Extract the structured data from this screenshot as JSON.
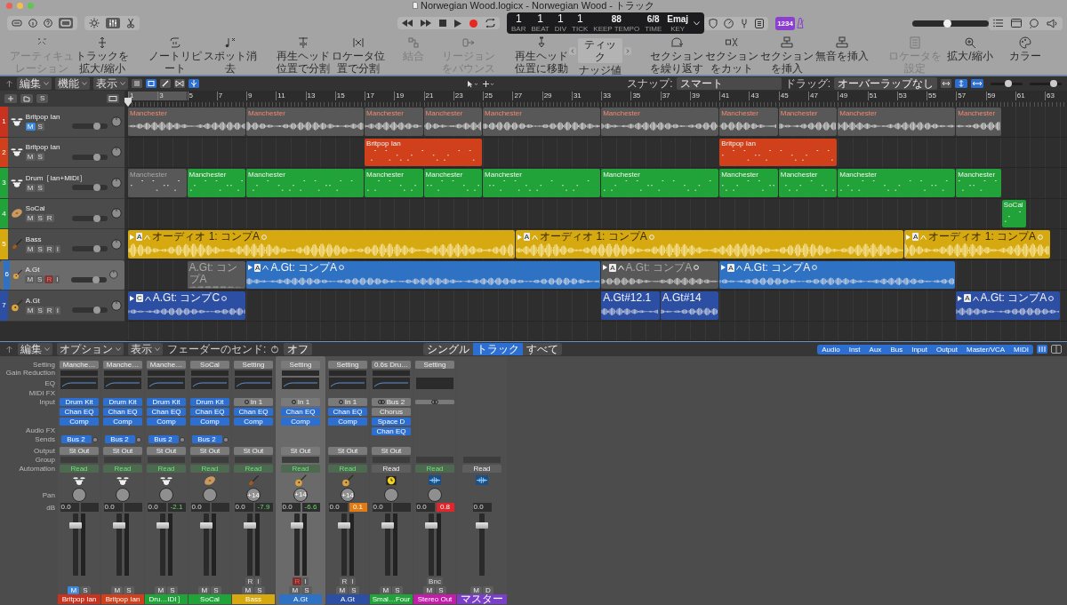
{
  "window": {
    "title": "Norwegian Wood.logicx - Norwegian Wood - トラック"
  },
  "lcd": {
    "fields": [
      {
        "value": "1",
        "label": "BAR"
      },
      {
        "value": "1",
        "label": "BEAT"
      },
      {
        "value": "1",
        "label": "DIV"
      },
      {
        "value": "1",
        "label": "TICK"
      }
    ],
    "tempo": {
      "value": "88",
      "mode": "KEEP",
      "label": "TEMPO"
    },
    "time": {
      "value": "6/8",
      "label": "TIME"
    },
    "key": {
      "value": "Emaj",
      "label": "KEY"
    }
  },
  "count_in": {
    "label": "1234",
    "on": true
  },
  "master_volume": {
    "level": 0.45
  },
  "toolbar": [
    {
      "kind": "button",
      "label": "アーティキュレーション",
      "disabled": true
    },
    {
      "kind": "button",
      "label": "トラックを拡大/縮小",
      "disabled": false
    },
    {
      "kind": "button",
      "label": "ノートリピート",
      "disabled": false
    },
    {
      "kind": "button",
      "label": "スポット消去",
      "disabled": false
    },
    {
      "kind": "button",
      "label": "再生ヘッド位置で分割",
      "disabled": false
    },
    {
      "kind": "button",
      "label": "ロケータ位置で分割",
      "disabled": false
    },
    {
      "kind": "button",
      "label": "結合",
      "disabled": true
    },
    {
      "kind": "button",
      "label": "リージョンをバウンス",
      "disabled": true
    },
    {
      "kind": "button",
      "label": "再生ヘッド位置に移動",
      "disabled": false
    },
    {
      "kind": "stepper",
      "value": "ティック",
      "label": "ナッジ値",
      "disabled": false
    },
    {
      "kind": "button",
      "label": "セクションを繰り返す",
      "disabled": false
    },
    {
      "kind": "button",
      "label": "セクションをカット",
      "disabled": false
    },
    {
      "kind": "button",
      "label": "セクションを挿入",
      "disabled": false
    },
    {
      "kind": "button",
      "label": "無音を挿入",
      "disabled": false
    },
    {
      "kind": "button",
      "label": "ロケータを設定",
      "disabled": true
    },
    {
      "kind": "button",
      "label": "拡大/縮小",
      "disabled": false
    },
    {
      "kind": "button",
      "label": "カラー",
      "disabled": false
    }
  ],
  "arrange": {
    "menus": [
      "編集",
      "機能",
      "表示"
    ],
    "solo_button": "S",
    "snap": {
      "label": "スナップ:",
      "value": "スマート"
    },
    "drag": {
      "label": "ドラッグ:",
      "value": "オーバーラップなし"
    },
    "zoom_sliders": [
      {
        "level": 0.55
      },
      {
        "level": 0.75
      }
    ],
    "ruler": [
      "1",
      "3",
      "5",
      "7",
      "9",
      "11",
      "13",
      "15",
      "17",
      "19",
      "21",
      "23",
      "25",
      "27",
      "29",
      "31",
      "33",
      "35",
      "37",
      "39",
      "41",
      "43",
      "45",
      "47",
      "49",
      "51",
      "53",
      "55",
      "57",
      "59",
      "61",
      "63"
    ],
    "tracks": [
      {
        "number": "1",
        "name": "Britpop Ian",
        "kind": "drum",
        "color": "#c8321e",
        "selected": false,
        "level": 0.7,
        "buttons": [
          {
            "label": "M",
            "kind": "mute",
            "on": true
          },
          {
            "label": "S",
            "kind": "solo",
            "on": false
          }
        ],
        "regions": [
          {
            "name": "Manchester",
            "kind": "audio",
            "muted": false
          },
          {
            "name": "Manchester",
            "kind": "audio",
            "muted": false
          },
          {
            "name": "Manchester",
            "kind": "audio",
            "muted": false
          },
          {
            "name": "Manchester",
            "kind": "audio",
            "muted": false
          },
          {
            "name": "Manchester",
            "kind": "audio",
            "muted": false
          },
          {
            "name": "Manchester",
            "kind": "audio",
            "muted": false
          },
          {
            "name": "Manchester",
            "kind": "audio",
            "muted": false
          },
          {
            "name": "Manchester",
            "kind": "audio",
            "muted": false
          },
          {
            "name": "Manchester",
            "kind": "audio",
            "muted": false
          },
          {
            "name": "Manchester",
            "kind": "audio",
            "muted": false
          }
        ]
      },
      {
        "number": "2",
        "name": "Britpop Ian",
        "kind": "drum",
        "color": "#d0401a",
        "selected": false,
        "level": 0.7,
        "buttons": [
          {
            "label": "M",
            "kind": "mute",
            "on": false
          },
          {
            "label": "S",
            "kind": "solo",
            "on": false
          }
        ],
        "regions": [
          {
            "name": "Britpop Ian",
            "kind": "midi",
            "muted": false
          },
          {
            "name": "Britpop Ian",
            "kind": "midi",
            "muted": false
          }
        ]
      },
      {
        "number": "3",
        "name": "Drum［Ian+MIDI］",
        "kind": "drum",
        "color": "#22a33a",
        "selected": false,
        "level": 0.7,
        "buttons": [
          {
            "label": "M",
            "kind": "mute",
            "on": false
          },
          {
            "label": "S",
            "kind": "solo",
            "on": false
          }
        ],
        "regions": [
          {
            "name": "Manchester",
            "kind": "midi",
            "muted": true
          },
          {
            "name": "Manchester",
            "kind": "midi",
            "muted": false
          },
          {
            "name": "Manchester",
            "kind": "midi",
            "muted": false
          },
          {
            "name": "Manchester",
            "kind": "midi",
            "muted": false
          },
          {
            "name": "Manchester",
            "kind": "midi",
            "muted": false
          },
          {
            "name": "Manchester",
            "kind": "midi",
            "muted": false
          },
          {
            "name": "Manchester",
            "kind": "midi",
            "muted": false
          },
          {
            "name": "Manchester",
            "kind": "midi",
            "muted": false
          },
          {
            "name": "Manchester",
            "kind": "midi",
            "muted": false
          },
          {
            "name": "Manchester",
            "kind": "midi",
            "muted": false
          },
          {
            "name": "Manchester",
            "kind": "midi",
            "muted": false
          }
        ]
      },
      {
        "number": "4",
        "name": "SoCal",
        "kind": "cymbal",
        "color": "#22a33a",
        "selected": false,
        "level": 0.7,
        "buttons": [
          {
            "label": "M",
            "kind": "mute",
            "on": false
          },
          {
            "label": "S",
            "kind": "solo",
            "on": false
          },
          {
            "label": "R",
            "kind": "record",
            "on": false
          }
        ],
        "regions": [
          {
            "name": "SoCal",
            "kind": "midi",
            "muted": false
          }
        ]
      },
      {
        "number": "5",
        "name": "Bass",
        "kind": "bass",
        "color": "#d6a911",
        "selected": false,
        "level": 0.7,
        "buttons": [
          {
            "label": "M",
            "kind": "mute",
            "on": false
          },
          {
            "label": "S",
            "kind": "solo",
            "on": false
          },
          {
            "label": "R",
            "kind": "record",
            "on": false
          },
          {
            "label": "I",
            "kind": "input",
            "on": false
          }
        ],
        "regions": [
          {
            "name": "オーディオ 1: コンプA",
            "take": "A",
            "kind": "audio",
            "muted": false
          },
          {
            "name": "オーディオ 1: コンプA",
            "take": "A",
            "kind": "audio",
            "muted": false
          },
          {
            "name": "オーディオ 1: コンプA",
            "take": "A",
            "kind": "audio",
            "muted": false
          }
        ]
      },
      {
        "number": "6",
        "name": "A.Gt",
        "kind": "guitar",
        "color": "#2f72c4",
        "selected": true,
        "level": 0.7,
        "buttons": [
          {
            "label": "M",
            "kind": "mute",
            "on": false
          },
          {
            "label": "S",
            "kind": "solo",
            "on": false
          },
          {
            "label": "R",
            "kind": "record",
            "on": true
          },
          {
            "label": "I",
            "kind": "input",
            "on": false
          }
        ],
        "regions": [
          {
            "name": "A.Gt: コンプA",
            "kind": "audio",
            "muted": true
          },
          {
            "name": "A.Gt: コンプA",
            "take": "A",
            "kind": "audio",
            "muted": false
          },
          {
            "name": "A.Gt: コンプA",
            "take": "A",
            "kind": "audio",
            "muted": true
          },
          {
            "name": "A.Gt: コンプA",
            "take": "A",
            "kind": "audio",
            "muted": false
          }
        ]
      },
      {
        "number": "7",
        "name": "A.Gt",
        "kind": "guitar",
        "color": "#2c4ea3",
        "selected": false,
        "level": 0.7,
        "buttons": [
          {
            "label": "M",
            "kind": "mute",
            "on": false
          },
          {
            "label": "S",
            "kind": "solo",
            "on": false
          },
          {
            "label": "R",
            "kind": "record",
            "on": false
          },
          {
            "label": "I",
            "kind": "input",
            "on": false
          }
        ],
        "regions": [
          {
            "name": "A.Gt: コンプC",
            "take": "C",
            "kind": "audio",
            "muted": false
          },
          {
            "name": "A.Gt#12.1",
            "kind": "audio",
            "muted": false
          },
          {
            "name": "A.Gt#14",
            "kind": "audio",
            "muted": false
          },
          {
            "name": "A.Gt: コンプA",
            "take": "A",
            "kind": "audio",
            "muted": false
          }
        ]
      }
    ]
  },
  "mixer": {
    "menus": [
      "編集",
      "オプション",
      "表示"
    ],
    "sends": {
      "label": "フェーダーのセンド:",
      "value": "オフ"
    },
    "views": [
      {
        "label": "シングル",
        "selected": false
      },
      {
        "label": "トラック",
        "selected": true
      },
      {
        "label": "すべて",
        "selected": false
      }
    ],
    "filters": [
      {
        "label": "Audio",
        "on": true
      },
      {
        "label": "Inst",
        "on": true
      },
      {
        "label": "Aux",
        "on": true
      },
      {
        "label": "Bus",
        "on": true
      },
      {
        "label": "Input",
        "on": true
      },
      {
        "label": "Output",
        "on": true
      },
      {
        "label": "Master/VCA",
        "on": true
      },
      {
        "label": "MIDI",
        "on": true
      }
    ],
    "row_labels": [
      "Setting",
      "Gain Reduction",
      "EQ",
      "MIDI FX",
      "Input",
      "Audio FX",
      "Sends",
      "Output",
      "Group",
      "Automation",
      "Pan",
      "dB"
    ],
    "channels": [
      {
        "name": "Britpop Ian",
        "kind": "drum",
        "color": "#c8321e",
        "selected": false,
        "setting": "Manche…",
        "eq": true,
        "input": {
          "kind": "instrument",
          "label": "Drum Kit"
        },
        "fx": [
          {
            "label": "Chan EQ",
            "on": true
          },
          {
            "label": "Comp",
            "on": true
          }
        ],
        "send": {
          "label": "Bus 2"
        },
        "output": "St Out",
        "automation": {
          "label": "Read",
          "on": true
        },
        "db": "0.0",
        "level": 0.8,
        "buttons": [
          {
            "label": "M",
            "kind": "mute",
            "on": true
          },
          {
            "label": "S",
            "kind": "solo",
            "on": false
          }
        ]
      },
      {
        "name": "Britpop Ian",
        "kind": "drum",
        "color": "#d0401a",
        "selected": false,
        "setting": "Manche…",
        "eq": true,
        "input": {
          "kind": "instrument",
          "label": "Drum Kit"
        },
        "fx": [
          {
            "label": "Chan EQ",
            "on": true
          },
          {
            "label": "Comp",
            "on": true
          }
        ],
        "send": {
          "label": "Bus 2"
        },
        "output": "St Out",
        "automation": {
          "label": "Read",
          "on": true
        },
        "db": "0.0",
        "level": 0.8,
        "buttons": [
          {
            "label": "M",
            "kind": "mute",
            "on": false
          },
          {
            "label": "S",
            "kind": "solo",
            "on": false
          }
        ]
      },
      {
        "name": "Dru…IDI］",
        "kind": "drum",
        "color": "#22a33a",
        "selected": false,
        "setting": "Manche…",
        "eq": true,
        "input": {
          "kind": "instrument",
          "label": "Drum Kit"
        },
        "fx": [
          {
            "label": "Chan EQ",
            "on": true
          },
          {
            "label": "Comp",
            "on": true
          }
        ],
        "send": {
          "label": "Bus 2"
        },
        "output": "St Out",
        "automation": {
          "label": "Read",
          "on": true
        },
        "db": "0.0",
        "peak": {
          "text": "-2.1",
          "kind": "ok"
        },
        "level": 0.8,
        "buttons": [
          {
            "label": "M",
            "kind": "mute",
            "on": false
          },
          {
            "label": "S",
            "kind": "solo",
            "on": false
          }
        ]
      },
      {
        "name": "SoCal",
        "kind": "cymbal",
        "color": "#22a33a",
        "selected": false,
        "setting": "SoCal",
        "eq": true,
        "input": {
          "kind": "instrument",
          "label": "Drum Kit"
        },
        "fx": [
          {
            "label": "Chan EQ",
            "on": true
          },
          {
            "label": "Comp",
            "on": true
          }
        ],
        "send": {
          "label": "Bus 2"
        },
        "output": "St Out",
        "automation": {
          "label": "Read",
          "on": true
        },
        "db": "0.0",
        "level": 0.8,
        "buttons": [
          {
            "label": "M",
            "kind": "mute",
            "on": false
          },
          {
            "label": "S",
            "kind": "solo",
            "on": false
          }
        ]
      },
      {
        "name": "Bass",
        "kind": "bass",
        "color": "#d6a911",
        "selected": false,
        "setting": "Setting",
        "eq": true,
        "input": {
          "kind": "mono",
          "label": "In 1"
        },
        "fx": [
          {
            "label": "Chan EQ",
            "on": true
          },
          {
            "label": "Comp",
            "on": true
          }
        ],
        "output": "St Out",
        "automation": {
          "label": "Read",
          "on": true
        },
        "pan": "+14",
        "db": "0.0",
        "peak": {
          "text": "-7.9",
          "kind": "ok"
        },
        "level": 0.8,
        "flags": [
          {
            "label": "R",
            "kind": "record",
            "on": false
          },
          {
            "label": "I",
            "kind": "input",
            "on": false
          }
        ],
        "buttons": [
          {
            "label": "M",
            "kind": "mute",
            "on": false
          },
          {
            "label": "S",
            "kind": "solo",
            "on": false
          }
        ]
      },
      {
        "name": "A.Gt",
        "kind": "guitar",
        "color": "#2f72c4",
        "selected": true,
        "setting": "Setting",
        "eq": true,
        "input": {
          "kind": "mono",
          "label": "In 1"
        },
        "fx": [
          {
            "label": "Chan EQ",
            "on": true
          },
          {
            "label": "Comp",
            "on": true
          }
        ],
        "output": "St Out",
        "automation": {
          "label": "Read",
          "on": true
        },
        "pan": "+14",
        "db": "0.0",
        "peak": {
          "text": "-6.6",
          "kind": "ok"
        },
        "level": 0.8,
        "flags": [
          {
            "label": "R",
            "kind": "record",
            "on": true
          },
          {
            "label": "I",
            "kind": "input",
            "on": false
          }
        ],
        "buttons": [
          {
            "label": "M",
            "kind": "mute",
            "on": false
          },
          {
            "label": "S",
            "kind": "solo",
            "on": false
          }
        ]
      },
      {
        "name": "A.Gt",
        "kind": "guitar",
        "color": "#2c4ea3",
        "selected": false,
        "setting": "Setting",
        "eq": true,
        "input": {
          "kind": "mono",
          "label": "In 1"
        },
        "fx": [
          {
            "label": "Chan EQ",
            "on": true
          },
          {
            "label": "Comp",
            "on": true
          }
        ],
        "output": "St Out",
        "automation": {
          "label": "Read",
          "on": true
        },
        "pan": "+14",
        "db": "0.0",
        "peak": {
          "text": "0.1",
          "kind": "warn"
        },
        "level": 0.8,
        "flags": [
          {
            "label": "R",
            "kind": "record",
            "on": false
          },
          {
            "label": "I",
            "kind": "input",
            "on": false
          }
        ],
        "buttons": [
          {
            "label": "M",
            "kind": "mute",
            "on": false
          },
          {
            "label": "S",
            "kind": "solo",
            "on": false
          }
        ]
      },
      {
        "name": "Smal…Four",
        "kind": "aux",
        "color": "#22a33a",
        "selected": false,
        "setting": "0.6s Dru…",
        "eq": true,
        "input": {
          "kind": "stereo",
          "label": "Bus 2"
        },
        "fx": [
          {
            "label": "Chorus",
            "on": false
          },
          {
            "label": "Space D",
            "on": true
          },
          {
            "label": "Chan EQ",
            "on": true
          }
        ],
        "output": "St Out",
        "automation": {
          "label": "Read",
          "on": false
        },
        "db": "0.0",
        "level": 0.8,
        "buttons": [
          {
            "label": "M",
            "kind": "mute",
            "on": false
          },
          {
            "label": "S",
            "kind": "solo",
            "on": false
          }
        ]
      },
      {
        "name": "Stereo Out",
        "kind": "output",
        "color": "#c21ca8",
        "selected": false,
        "setting": "Setting",
        "eq": false,
        "input": {
          "kind": "stereo"
        },
        "automation": {
          "label": "Read",
          "on": true
        },
        "db": "0.0",
        "peak": {
          "text": "0.8",
          "kind": "clip"
        },
        "level": 0.8,
        "flags": [
          {
            "label": "Bnc",
            "kind": "bounce",
            "on": false
          }
        ],
        "buttons": [
          {
            "label": "M",
            "kind": "mute",
            "on": false
          },
          {
            "label": "S",
            "kind": "solo",
            "on": false
          }
        ]
      },
      {
        "name": "マスター",
        "kind": "master",
        "color": "#7a3fc8",
        "selected": false,
        "automation": {
          "label": "Read",
          "on": false
        },
        "db": "0.0",
        "level": 0.8,
        "buttons": [
          {
            "label": "M",
            "kind": "mute",
            "on": false
          },
          {
            "label": "D",
            "kind": "dim",
            "on": false
          }
        ]
      }
    ]
  }
}
